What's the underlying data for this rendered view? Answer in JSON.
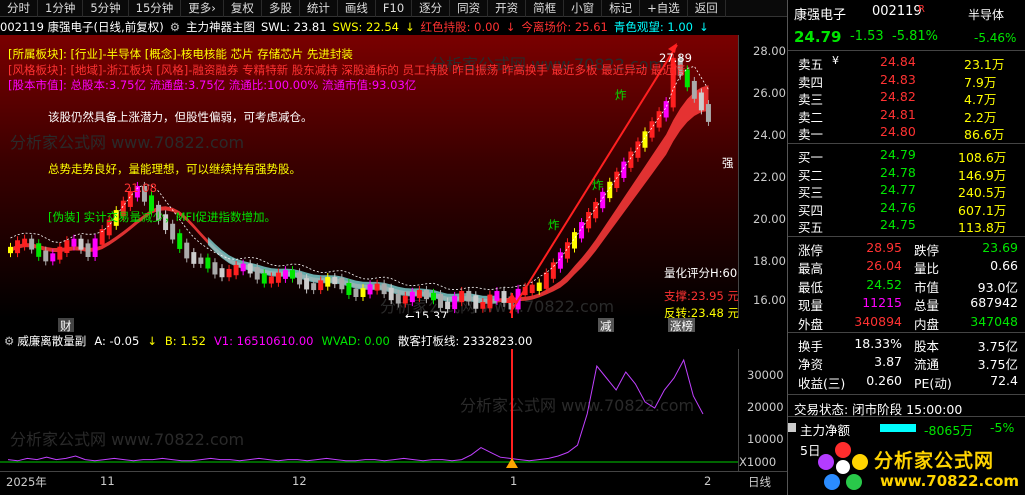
{
  "toolbar": {
    "items": [
      "分时",
      "1分钟",
      "5分钟",
      "15分钟",
      "更多",
      "复权",
      "多股",
      "统计",
      "画线",
      "F10",
      "逐分",
      "同资",
      "开资",
      "简框",
      "小窗",
      "标记",
      "+自选",
      "返回"
    ],
    "more_arrow": "›"
  },
  "info": {
    "code_name": "002119 康强电子(日线,前复权)",
    "indicator": "主力神器主图",
    "swl": "SWL: 23.81",
    "sws": "SWS: 22.54",
    "red_hold": "红色持股: 0.00",
    "exit_price": "今离场价: 25.61",
    "cyan_watch": "青色观望: 1.00"
  },
  "overlay": {
    "sector_label": "[所属板块]:",
    "sector_value": "[行业]-半导体 [概念]-核电核能 芯片 存储芯片 先进封装",
    "style_label": "[风格板块]:",
    "style_value": "[地域]-浙江板块 [风格]-融资融券 专精特新 股东减持 深股通标的 员工持股 昨日振荡 昨高换手 最近多板 最近异动 最近情",
    "market_label": "[股本市值]:",
    "market_value": "总股本:3.75亿 流通盘:3.75亿 流通比:100.00% 流通市值:93.03亿",
    "comment1": "该股仍然具备上涨潜力，但股性偏弱，可考虑减仓。",
    "comment2": "总势走势良好，量能理想，可以继续持有强势股。",
    "comment3": "[伪装] 实计交易量减少，MFI促进指数增加。",
    "high_mark": "21.08",
    "low_mark": "←15.37",
    "peak_mark": "27.89",
    "qiang_mark": "强",
    "score": "量化评分H:60",
    "support": "支撑:23.95 元",
    "reversal": "反转:23.48 元",
    "zha1": "炸",
    "zha2": "炸",
    "zha3": "炸",
    "cai": "财",
    "jian": "减",
    "zhangbang": "涨榜",
    "watermark": "分析家公式网 www.70822.com"
  },
  "yaxis": [
    "28.00",
    "26.00",
    "24.00",
    "22.00",
    "20.00",
    "18.00",
    "16.00"
  ],
  "indicator_header": {
    "title": "威廉离散量副",
    "a": "A: -0.05",
    "b": "B: 1.52",
    "v1": "V1: 16510610.00",
    "wvad": "WVAD: 0.00",
    "retail": "散客打板线: 2332823.00"
  },
  "ind_yaxis": [
    "30000",
    "20000",
    "10000"
  ],
  "ind_unit": "X1000",
  "xaxis": {
    "year": "2025年",
    "m11": "11",
    "m12": "12",
    "m1": "1",
    "m2": "2",
    "daily": "日线"
  },
  "right": {
    "name": "康强电子",
    "code": "002119",
    "r_mark": "R",
    "sector": "半导体",
    "price": "24.79",
    "change": "-1.53",
    "pct": "-5.81%",
    "sector_pct": "-5.46%",
    "sells": [
      [
        "卖五",
        "¥",
        "24.84",
        "23.1万"
      ],
      [
        "卖四",
        "",
        "24.83",
        "7.9万"
      ],
      [
        "卖三",
        "",
        "24.82",
        "4.7万"
      ],
      [
        "卖二",
        "",
        "24.81",
        "2.2万"
      ],
      [
        "卖一",
        "",
        "24.80",
        "86.6万"
      ]
    ],
    "buys": [
      [
        "买一",
        "24.79",
        "108.6万"
      ],
      [
        "买二",
        "24.78",
        "146.9万"
      ],
      [
        "买三",
        "24.77",
        "240.5万"
      ],
      [
        "买四",
        "24.76",
        "607.1万"
      ],
      [
        "买五",
        "24.75",
        "113.8万"
      ]
    ],
    "stats": [
      [
        "涨停",
        "28.95",
        "跌停",
        "23.69"
      ],
      [
        "最高",
        "26.04",
        "量比",
        "0.66"
      ],
      [
        "最低",
        "24.52",
        "市值",
        "93.0亿"
      ],
      [
        "现量",
        "11215",
        "总量",
        "687942"
      ],
      [
        "外盘",
        "340894",
        "内盘",
        "347048"
      ]
    ],
    "stats2": [
      [
        "换手",
        "18.33%",
        "股本",
        "3.75亿"
      ],
      [
        "净资",
        "3.87",
        "流通",
        "3.75亿"
      ],
      [
        "收益(三)",
        "0.260",
        "PE(动)",
        "72.4"
      ]
    ],
    "trade_status": "交易状态: 闭市阶段 15:00:00",
    "main_net_label": "主力净额",
    "main_net_value": "-8065万",
    "main_net_pct": "-5%",
    "five_day": "5日",
    "logo_text": "分析家公式网",
    "logo_url": "www.70822.com"
  }
}
